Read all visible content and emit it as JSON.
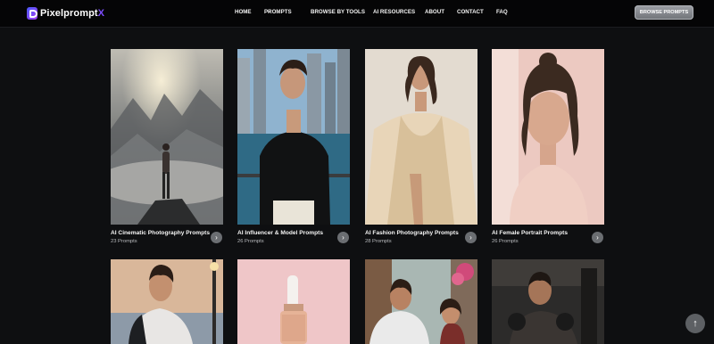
{
  "brand": {
    "name_main": "Pixelprompt",
    "name_accent": "X"
  },
  "nav": {
    "home": "HOME",
    "prompts": "PROMPTS",
    "browse_tools": "BROWSE BY TOOLS",
    "ai_resources": "AI RESOURCES",
    "about": "ABOUT",
    "contact": "CONTACT",
    "faq": "FAQ"
  },
  "header_button": "BROWSE PROMPTS",
  "cards": [
    {
      "title": "AI Cinematic Photography Prompts",
      "count": "23 Prompts"
    },
    {
      "title": "AI Influencer & Model Prompts",
      "count": "26 Prompts"
    },
    {
      "title": "AI Fashion Photography Prompts",
      "count": "28 Prompts"
    },
    {
      "title": "AI Female Portrait Prompts",
      "count": "26 Prompts"
    }
  ],
  "icons": {
    "logo": "pixelpromptx-logo-icon",
    "nav_dropdown": "chevron-down-icon",
    "card_arrow": "chevron-right-icon",
    "scroll_top": "arrow-up-icon"
  },
  "colors": {
    "page_bg": "#0e0f11",
    "header_bg": "#050506",
    "brand_accent": "#7d4dff",
    "button_gray": "#808388"
  }
}
